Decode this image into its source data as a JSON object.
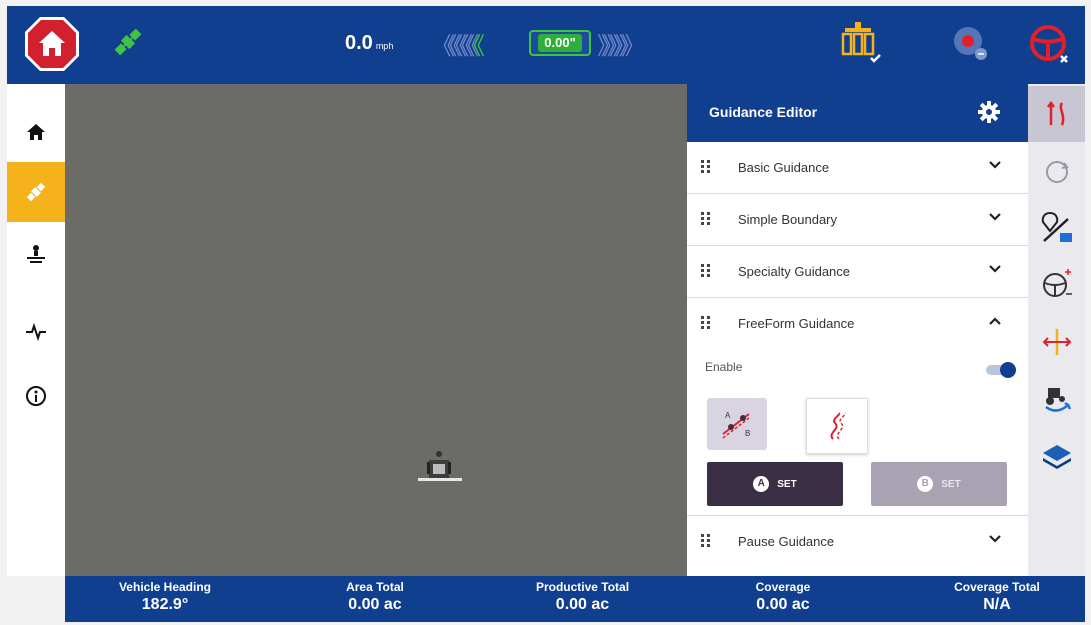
{
  "topbar": {
    "speed_value": "0.0",
    "speed_unit": "mph",
    "chevrons_left": "《《《《《",
    "chevron_active": "《",
    "heading_offset": "0.00\"",
    "chevrons_right": "》》》》》"
  },
  "sidebar": {
    "items": [
      {
        "icon": "home-icon"
      },
      {
        "icon": "guidance-icon",
        "active": true
      },
      {
        "icon": "field-icon"
      },
      {
        "icon": "diagnostics-icon"
      },
      {
        "icon": "info-icon"
      }
    ]
  },
  "panel": {
    "title": "Guidance Editor",
    "sections": {
      "basic": "Basic Guidance",
      "boundary": "Simple Boundary",
      "specialty": "Specialty Guidance",
      "freeform": "FreeForm Guidance",
      "pause": "Pause Guidance"
    },
    "enable_label": "Enable",
    "enable_on": true,
    "set_a_letter": "A",
    "set_a_label": "SET",
    "set_b_letter": "B",
    "set_b_label": "SET"
  },
  "status": {
    "heading_title": "Vehicle Heading",
    "heading_value": "182.9°",
    "area_title": "Area Total",
    "area_value": "0.00 ac",
    "productive_title": "Productive Total",
    "productive_value": "0.00 ac",
    "coverage_title": "Coverage",
    "coverage_value": "0.00 ac",
    "coverage_total_title": "Coverage Total",
    "coverage_total_value": "N/A"
  },
  "colors": {
    "brand_blue": "#103f8f",
    "active_yellow": "#f5b21a",
    "home_red": "#d2202f",
    "gps_green": "#3ec43e",
    "map_gray": "#6b6b67"
  }
}
